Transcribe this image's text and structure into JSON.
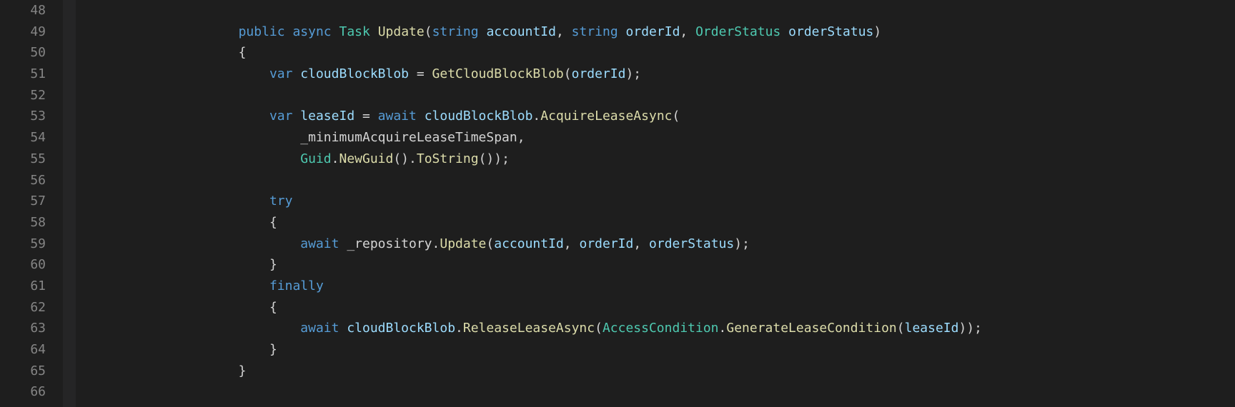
{
  "gutter": {
    "start": 48,
    "end": 66
  },
  "code": {
    "colors": {
      "keyword": "#569cd6",
      "type": "#4ec9b0",
      "method": "#dcdcaa",
      "identifier": "#9cdcfe",
      "plain": "#d4d4d4",
      "gutter": "#858585",
      "background": "#1e1e1e"
    },
    "lines": [
      {
        "indent": 2,
        "tokens": []
      },
      {
        "indent": 2,
        "tokens": [
          {
            "t": "public",
            "c": "kw"
          },
          {
            "t": " ",
            "c": "plain"
          },
          {
            "t": "async",
            "c": "kw"
          },
          {
            "t": " ",
            "c": "plain"
          },
          {
            "t": "Task",
            "c": "type"
          },
          {
            "t": " ",
            "c": "plain"
          },
          {
            "t": "Update",
            "c": "method"
          },
          {
            "t": "(",
            "c": "plain"
          },
          {
            "t": "string",
            "c": "kw"
          },
          {
            "t": " ",
            "c": "plain"
          },
          {
            "t": "accountId",
            "c": "param"
          },
          {
            "t": ", ",
            "c": "plain"
          },
          {
            "t": "string",
            "c": "kw"
          },
          {
            "t": " ",
            "c": "plain"
          },
          {
            "t": "orderId",
            "c": "param"
          },
          {
            "t": ", ",
            "c": "plain"
          },
          {
            "t": "OrderStatus",
            "c": "type"
          },
          {
            "t": " ",
            "c": "plain"
          },
          {
            "t": "orderStatus",
            "c": "param"
          },
          {
            "t": ")",
            "c": "plain"
          }
        ]
      },
      {
        "indent": 2,
        "tokens": [
          {
            "t": "{",
            "c": "plain"
          }
        ]
      },
      {
        "indent": 3,
        "tokens": [
          {
            "t": "var",
            "c": "kw"
          },
          {
            "t": " ",
            "c": "plain"
          },
          {
            "t": "cloudBlockBlob",
            "c": "var"
          },
          {
            "t": " = ",
            "c": "plain"
          },
          {
            "t": "GetCloudBlockBlob",
            "c": "method"
          },
          {
            "t": "(",
            "c": "plain"
          },
          {
            "t": "orderId",
            "c": "var"
          },
          {
            "t": ");",
            "c": "plain"
          }
        ]
      },
      {
        "indent": 3,
        "tokens": []
      },
      {
        "indent": 3,
        "tokens": [
          {
            "t": "var",
            "c": "kw"
          },
          {
            "t": " ",
            "c": "plain"
          },
          {
            "t": "leaseId",
            "c": "var"
          },
          {
            "t": " = ",
            "c": "plain"
          },
          {
            "t": "await",
            "c": "kw"
          },
          {
            "t": " ",
            "c": "plain"
          },
          {
            "t": "cloudBlockBlob",
            "c": "var"
          },
          {
            "t": ".",
            "c": "plain"
          },
          {
            "t": "AcquireLeaseAsync",
            "c": "method"
          },
          {
            "t": "(",
            "c": "plain"
          }
        ]
      },
      {
        "indent": 4,
        "tokens": [
          {
            "t": "_minimumAcquireLeaseTimeSpan",
            "c": "field"
          },
          {
            "t": ",",
            "c": "plain"
          }
        ]
      },
      {
        "indent": 4,
        "tokens": [
          {
            "t": "Guid",
            "c": "type"
          },
          {
            "t": ".",
            "c": "plain"
          },
          {
            "t": "NewGuid",
            "c": "method"
          },
          {
            "t": "().",
            "c": "plain"
          },
          {
            "t": "ToString",
            "c": "method"
          },
          {
            "t": "());",
            "c": "plain"
          }
        ]
      },
      {
        "indent": 3,
        "tokens": []
      },
      {
        "indent": 3,
        "tokens": [
          {
            "t": "try",
            "c": "kw"
          }
        ]
      },
      {
        "indent": 3,
        "tokens": [
          {
            "t": "{",
            "c": "plain"
          }
        ]
      },
      {
        "indent": 4,
        "tokens": [
          {
            "t": "await",
            "c": "kw"
          },
          {
            "t": " ",
            "c": "plain"
          },
          {
            "t": "_repository",
            "c": "field"
          },
          {
            "t": ".",
            "c": "plain"
          },
          {
            "t": "Update",
            "c": "method"
          },
          {
            "t": "(",
            "c": "plain"
          },
          {
            "t": "accountId",
            "c": "var"
          },
          {
            "t": ", ",
            "c": "plain"
          },
          {
            "t": "orderId",
            "c": "var"
          },
          {
            "t": ", ",
            "c": "plain"
          },
          {
            "t": "orderStatus",
            "c": "var"
          },
          {
            "t": ");",
            "c": "plain"
          }
        ]
      },
      {
        "indent": 3,
        "tokens": [
          {
            "t": "}",
            "c": "plain"
          }
        ]
      },
      {
        "indent": 3,
        "tokens": [
          {
            "t": "finally",
            "c": "kw"
          }
        ]
      },
      {
        "indent": 3,
        "tokens": [
          {
            "t": "{",
            "c": "plain"
          }
        ]
      },
      {
        "indent": 4,
        "tokens": [
          {
            "t": "await",
            "c": "kw"
          },
          {
            "t": " ",
            "c": "plain"
          },
          {
            "t": "cloudBlockBlob",
            "c": "var"
          },
          {
            "t": ".",
            "c": "plain"
          },
          {
            "t": "ReleaseLeaseAsync",
            "c": "method"
          },
          {
            "t": "(",
            "c": "plain"
          },
          {
            "t": "AccessCondition",
            "c": "type"
          },
          {
            "t": ".",
            "c": "plain"
          },
          {
            "t": "GenerateLeaseCondition",
            "c": "method"
          },
          {
            "t": "(",
            "c": "plain"
          },
          {
            "t": "leaseId",
            "c": "var"
          },
          {
            "t": "));",
            "c": "plain"
          }
        ]
      },
      {
        "indent": 3,
        "tokens": [
          {
            "t": "}",
            "c": "plain"
          }
        ]
      },
      {
        "indent": 2,
        "tokens": [
          {
            "t": "}",
            "c": "plain"
          }
        ]
      },
      {
        "indent": 2,
        "tokens": []
      }
    ]
  }
}
